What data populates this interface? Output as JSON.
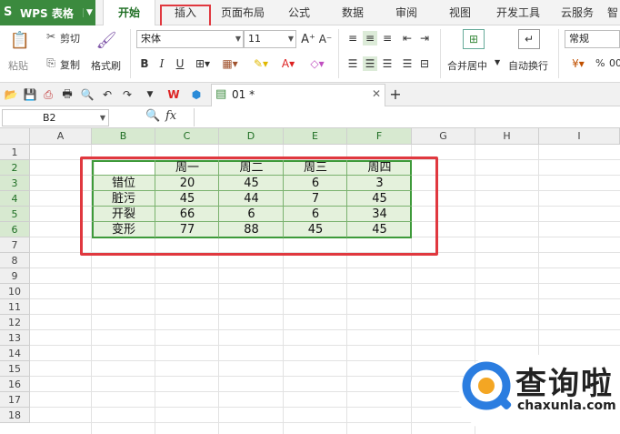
{
  "app": {
    "name": "WPS 表格"
  },
  "tabs": [
    "开始",
    "插入",
    "页面布局",
    "公式",
    "数据",
    "审阅",
    "视图",
    "开发工具",
    "云服务",
    "智"
  ],
  "active_tab": "开始",
  "ribbon": {
    "paste": "粘贴",
    "cut": "剪切",
    "copy": "复制",
    "format_painter": "格式刷",
    "font_name": "宋体",
    "font_size": "11",
    "merge_center": "合并居中",
    "wrap_text": "自动换行",
    "number_format": "常规",
    "percent": "%"
  },
  "document": {
    "tab_name": "01 *"
  },
  "formula_bar": {
    "cell_ref": "B2",
    "fx": "fx"
  },
  "sheet": {
    "columns": [
      "A",
      "B",
      "C",
      "D",
      "E",
      "F",
      "G",
      "H",
      "I"
    ],
    "rows": [
      "1",
      "2",
      "3",
      "4",
      "5",
      "6",
      "7",
      "8",
      "9",
      "10",
      "11",
      "12",
      "13",
      "14",
      "15",
      "16",
      "17",
      "18"
    ],
    "table": {
      "header": [
        "",
        "周一",
        "周二",
        "周三",
        "周四"
      ],
      "rows": [
        [
          "错位",
          "20",
          "45",
          "6",
          "3"
        ],
        [
          "脏污",
          "45",
          "44",
          "7",
          "45"
        ],
        [
          "开裂",
          "66",
          "6",
          "6",
          "34"
        ],
        [
          "变形",
          "77",
          "88",
          "45",
          "45"
        ]
      ]
    }
  },
  "watermark": {
    "text": "查询啦",
    "url": "chaxunla.com"
  },
  "colors": {
    "accent": "#3b8a3e",
    "highlight": "#e0383f",
    "selection": "#e4f1dc"
  }
}
